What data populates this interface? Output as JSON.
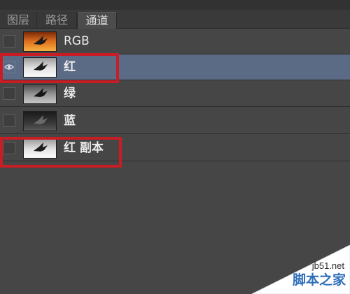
{
  "tabs": [
    {
      "label": "图层",
      "active": false
    },
    {
      "label": "路径",
      "active": false
    },
    {
      "label": "通道",
      "active": true
    }
  ],
  "channels": [
    {
      "label": "RGB",
      "visible": false,
      "selected": false,
      "thumbnail": "color-eagle-icon"
    },
    {
      "label": "红",
      "visible": true,
      "selected": true,
      "thumbnail": "light-eagle-icon"
    },
    {
      "label": "绿",
      "visible": false,
      "selected": false,
      "thumbnail": "gray-eagle-icon"
    },
    {
      "label": "蓝",
      "visible": false,
      "selected": false,
      "thumbnail": "dark-eagle-icon"
    },
    {
      "label": "红 副本",
      "visible": false,
      "selected": false,
      "thumbnail": "light-eagle-icon"
    }
  ],
  "highlight_color": "#c81d24",
  "selection_color": "#5b6a85",
  "watermark": {
    "site": "jb51.net",
    "name": "脚本之家"
  }
}
